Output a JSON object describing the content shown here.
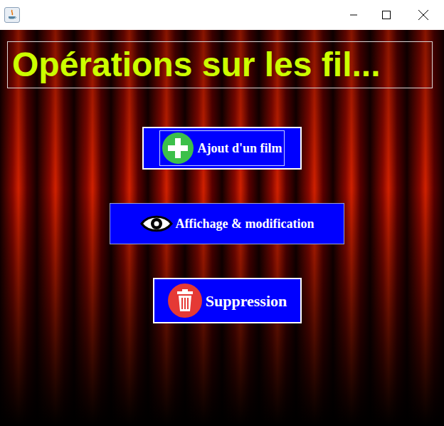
{
  "heading": "Opérations sur les fil...",
  "buttons": [
    {
      "label": "Ajout d'un film",
      "kind": "add",
      "focused": true
    },
    {
      "label": "Affichage & modification",
      "kind": "view",
      "focused": false
    },
    {
      "label": "Suppression",
      "kind": "delete",
      "focused": false
    }
  ]
}
